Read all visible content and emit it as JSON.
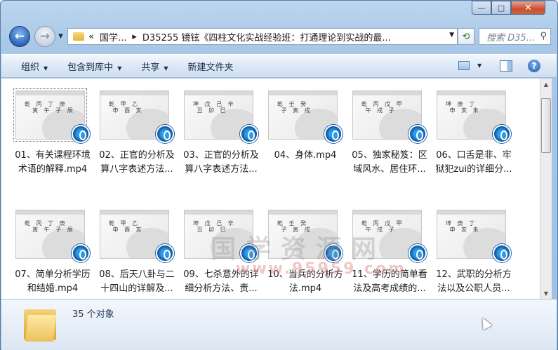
{
  "address": {
    "path": [
      "«",
      "国学...",
      "▸",
      "D35255 镜铉《四柱文化实战经验班：打通理论到实战的最..."
    ],
    "search_placeholder": "搜索 D35..."
  },
  "toolbar": {
    "organize": "组织",
    "include_library": "包含到库中",
    "share": "共享",
    "new_folder": "新建文件夹"
  },
  "files": [
    {
      "line1": "01、有关课程环境",
      "line2": "术语的解释.mp4",
      "selected": true
    },
    {
      "line1": "02、正官的分析及",
      "line2": "算八字表述方法..."
    },
    {
      "line1": "03、正官的分析及",
      "line2": "算八字表述方法..."
    },
    {
      "line1": "04、身体.mp4",
      "line2": ""
    },
    {
      "line1": "05、独家秘笈：区",
      "line2": "域风水、居住环..."
    },
    {
      "line1": "06、口舌是非、牢",
      "line2": "狱犯zui的详细分..."
    },
    {
      "line1": "07、简单分析学历",
      "line2": "和结婚.mp4"
    },
    {
      "line1": "08、后天八卦与二",
      "line2": "十四山的详解及..."
    },
    {
      "line1": "09、七杀意外的详",
      "line2": "细分析方法、责..."
    },
    {
      "line1": "10、当兵的分析方",
      "line2": "法.mp4"
    },
    {
      "line1": "11、学历的简单看",
      "line2": "法及高考成绩的..."
    },
    {
      "line1": "12、武职的分析方",
      "line2": "法以及公职人员..."
    }
  ],
  "status": {
    "count": "35 个对象"
  },
  "watermark": {
    "line1": "国学资源网",
    "line2": "www.95959.com"
  },
  "window_buttons": {
    "minimize": "—",
    "maximize": "□",
    "close": "✕"
  }
}
